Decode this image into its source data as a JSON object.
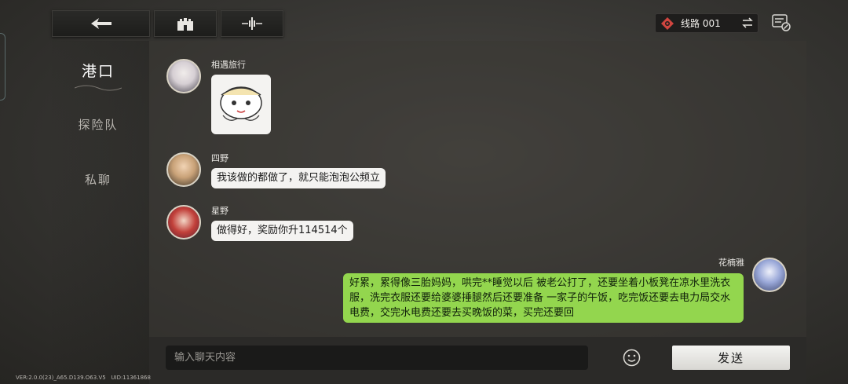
{
  "topbar": {
    "back_icon": "back-arrow-icon",
    "home_icon": "castle-icon",
    "voice_icon": "waveform-icon",
    "channel_label": "线路 001",
    "channel_icon": "diamond-gear-icon",
    "swap_icon": "swap-arrows-icon",
    "chat_log_icon": "chat-settings-icon"
  },
  "sidebar": {
    "items": [
      {
        "label": "港口",
        "active": true
      },
      {
        "label": "探险队",
        "active": false
      },
      {
        "label": "私聊",
        "active": false
      }
    ]
  },
  "messages": [
    {
      "sender": "相遇旅行",
      "type": "sticker",
      "sticker_icon": "chibi-sticker-icon"
    },
    {
      "sender": "四野",
      "type": "text",
      "text": "我该做的都做了，就只能泡泡公频立"
    },
    {
      "sender": "星野",
      "type": "text",
      "text": "做得好，奖励你升114514个"
    },
    {
      "sender": "花楠雅",
      "type": "self",
      "text": "好累，累得像三胎妈妈，哄完**睡觉以后 被老公打了，还要坐着小板凳在凉水里洗衣服，洗完衣服还要给婆婆捶腿然后还要准备 一家子的午饭，吃完饭还要去电力局交水电费，交完水电费还要去买晚饭的菜，买完还要回"
    }
  ],
  "input": {
    "placeholder": "输入聊天内容",
    "emoji_icon": "smiley-icon",
    "send_label": "发送"
  },
  "footer": {
    "version": "VER:2.0.0(23)_A65.D139.O63.V5",
    "uid": "UID:11361868"
  },
  "colors": {
    "self_bubble": "#93d64e",
    "other_bubble": "#f4f3f1",
    "channel_icon": "#d0453f"
  }
}
